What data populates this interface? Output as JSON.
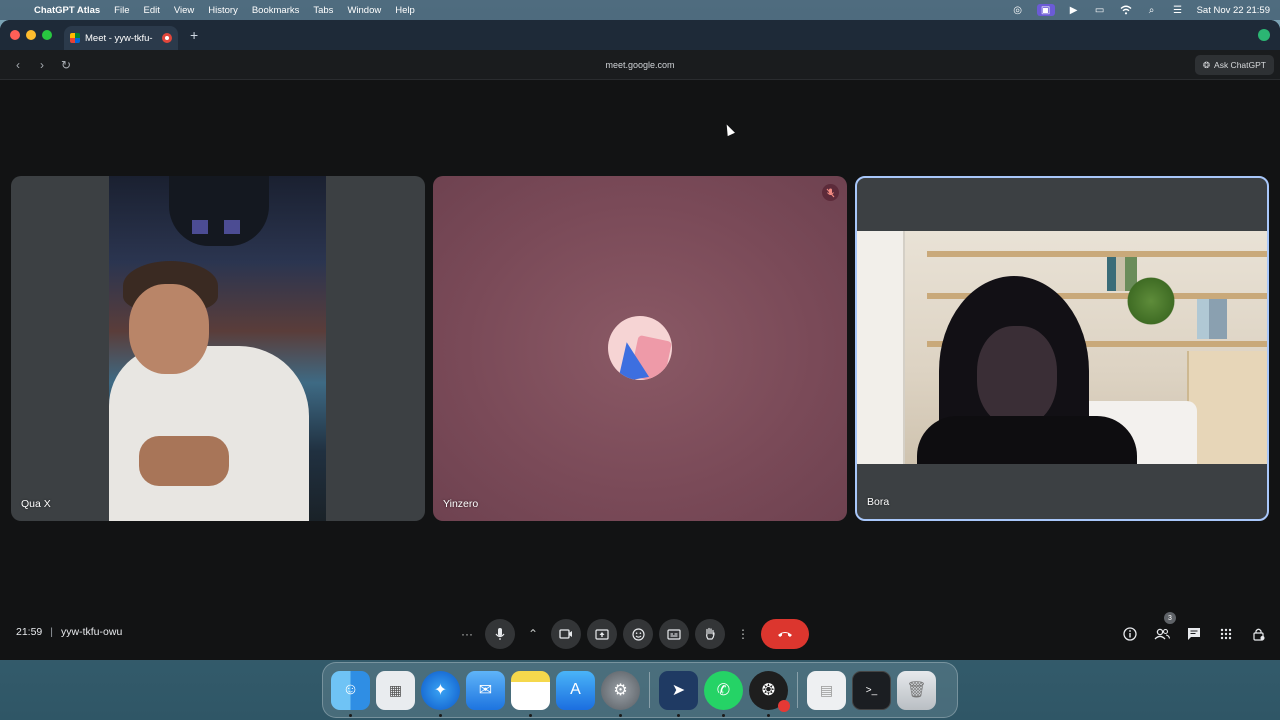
{
  "menubar": {
    "app_name": "ChatGPT Atlas",
    "items": [
      "File",
      "Edit",
      "View",
      "History",
      "Bookmarks",
      "Tabs",
      "Window",
      "Help"
    ],
    "clock": "Sat Nov 22  21:59"
  },
  "browser": {
    "tab_title": "Meet - yyw-tkfu-",
    "url": "meet.google.com",
    "ask_button": "Ask ChatGPT",
    "new_tab_symbol": "+"
  },
  "meet": {
    "participants": [
      {
        "name": "Qua X"
      },
      {
        "name": "Yinzero",
        "muted": true
      },
      {
        "name": "Bora",
        "active_speaker": true
      }
    ],
    "time": "21:59",
    "separator": "|",
    "meeting_code": "yyw-tkfu-owu",
    "people_count": "3",
    "colors": {
      "end_call": "#dc362e",
      "highlight": "#a8c7fa",
      "tile_bg": "#3c4043"
    }
  },
  "dock": {
    "apps": [
      "finder-icon",
      "launchpad-icon",
      "safari-icon",
      "mail-icon",
      "notes-icon",
      "app-store-icon",
      "system-settings-icon",
      "telegram-icon",
      "whatsapp-icon",
      "chatgpt-icon",
      "document-icon",
      "terminal-icon",
      "trash-icon"
    ]
  }
}
